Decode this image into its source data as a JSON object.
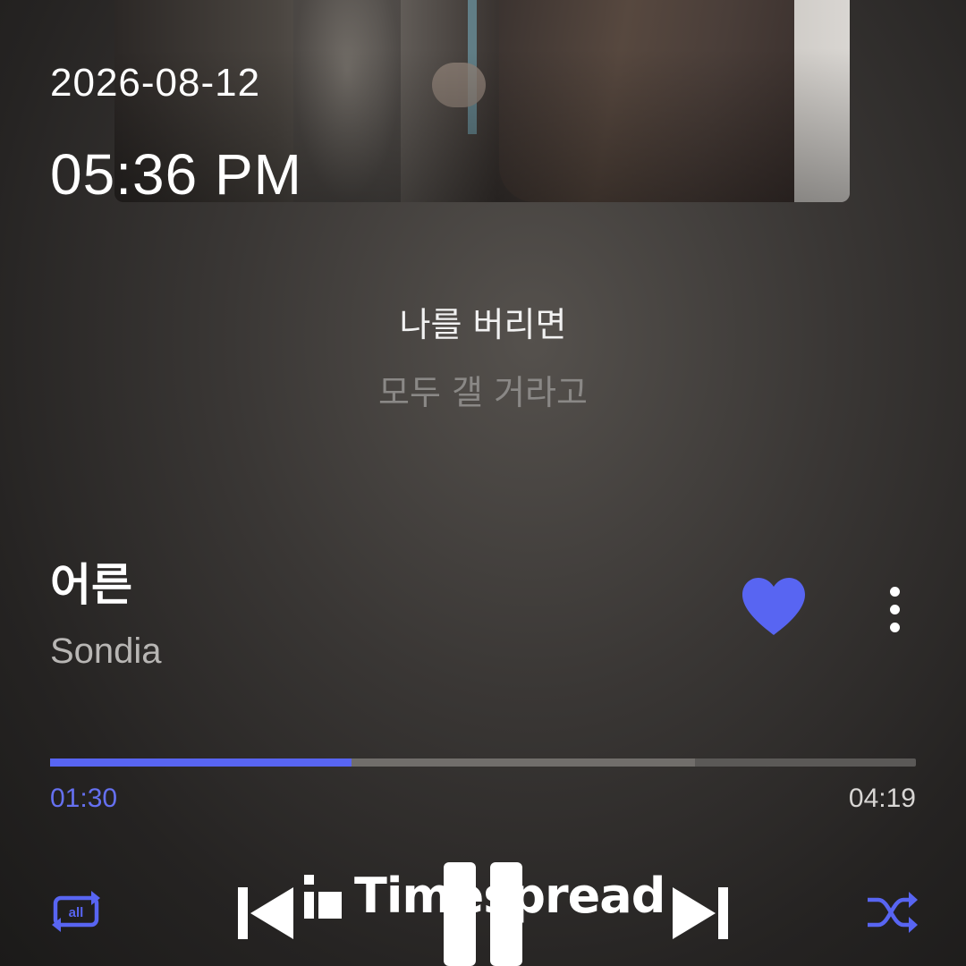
{
  "status": {
    "date": "2026-08-12",
    "time": "05:36 PM"
  },
  "lyrics": {
    "current": "나를 버리면",
    "next": "모두 갤 거라고"
  },
  "track": {
    "title": "어른",
    "artist": "Sondia",
    "liked": true,
    "accent_color": "#5865f2"
  },
  "playback": {
    "elapsed": "01:30",
    "duration": "04:19",
    "progress_fraction": 0.348,
    "buffered_fraction": 0.745,
    "state": "playing"
  },
  "controls": {
    "repeat_label": "all",
    "repeat_icon": "repeat-all-icon",
    "prev_icon": "skip-previous-icon",
    "pause_icon": "pause-icon",
    "next_icon": "skip-next-icon",
    "shuffle_icon": "shuffle-icon",
    "more_icon": "more-vertical-icon",
    "like_icon": "heart-icon"
  },
  "watermark": {
    "text": "Timespread"
  }
}
